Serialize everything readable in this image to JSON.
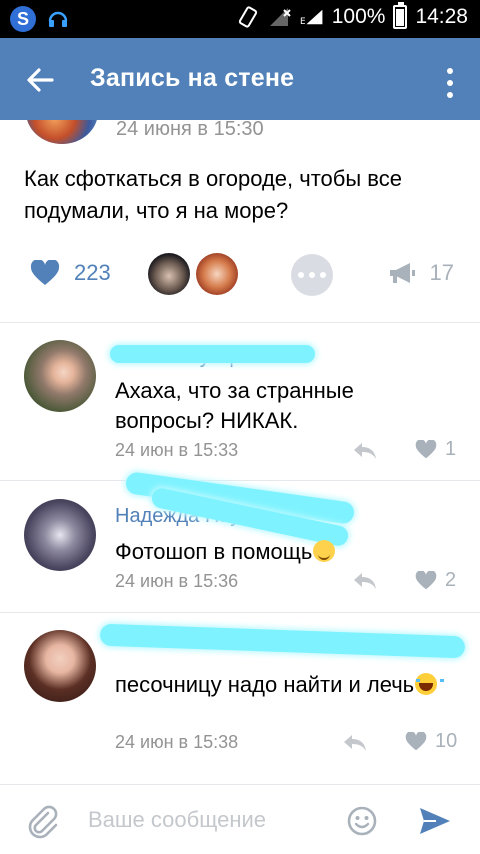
{
  "status_bar": {
    "battery": "100%",
    "time": "14:28",
    "app_icon_letter": "S"
  },
  "header": {
    "title": "Запись на стене"
  },
  "post": {
    "date": "24 июня в 15:30",
    "text": "Как сфоткаться в огороде, чтобы все подумали, что я на море?",
    "likes": "223",
    "shares": "17"
  },
  "comments": [
    {
      "name": "Галина Рубцова",
      "text": "Ахаха, что за странные вопросы? НИКАК.",
      "date": "24 июн в 15:33",
      "likes": "1"
    },
    {
      "name": "Надежда Наумова",
      "text": "Фотошоп в помощь",
      "date": "24 июн в 15:36",
      "likes": "2"
    },
    {
      "name": "",
      "text": "песочницу надо найти и лечь",
      "date": "24 июн в 15:38",
      "likes": "10"
    }
  ],
  "composer": {
    "placeholder": "Ваше сообщение"
  },
  "colors": {
    "accent": "#5181b8",
    "muted": "#939393",
    "icon_gray": "#a9b1bb"
  }
}
